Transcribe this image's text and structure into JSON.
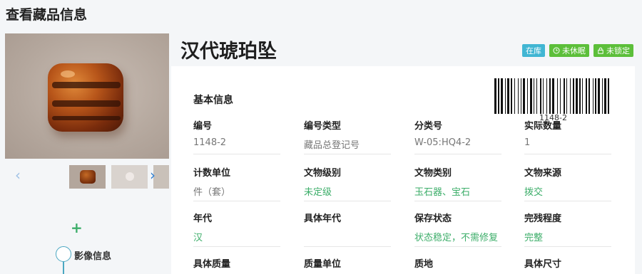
{
  "page": {
    "title": "查看藏品信息"
  },
  "gallery": {
    "prev_icon": "chevron-left-icon",
    "next_icon": "chevron-right-icon"
  },
  "timeline": {
    "add_icon": "plus-icon",
    "label": "影像信息"
  },
  "relic": {
    "name": "汉代琥珀坠",
    "badges": [
      {
        "label": "在库",
        "icon": "",
        "color": "#41b6d3"
      },
      {
        "label": "未休眠",
        "icon": "clock-icon",
        "color": "#5cbf3a"
      },
      {
        "label": "未锁定",
        "icon": "lock-icon",
        "color": "#5cbf3a"
      }
    ],
    "barcode_text": "1148-2"
  },
  "basic_info": {
    "section_title": "基本信息",
    "fields": [
      {
        "label": "编号",
        "value": "1148-2"
      },
      {
        "label": "编号类型",
        "value": "藏品总登记号"
      },
      {
        "label": "分类号",
        "value": "W-05:HQ4-2"
      },
      {
        "label": "实际数量",
        "value": "1"
      },
      {
        "label": "计数单位",
        "value": "件（套）"
      },
      {
        "label": "文物级别",
        "value": "未定级"
      },
      {
        "label": "文物类别",
        "value": "玉石器、宝石"
      },
      {
        "label": "文物来源",
        "value": "拨交"
      },
      {
        "label": "年代",
        "value": "汉"
      },
      {
        "label": "具体年代",
        "value": ""
      },
      {
        "label": "保存状态",
        "value": "状态稳定，不需修复"
      },
      {
        "label": "完残程度",
        "value": "完整"
      },
      {
        "label": "具体质量",
        "value": ""
      },
      {
        "label": "质量单位",
        "value": ""
      },
      {
        "label": "质地",
        "value": ""
      },
      {
        "label": "具体尺寸",
        "value": ""
      }
    ]
  },
  "colors": {
    "accent_green": "#3dae6a",
    "badge_blue": "#41b6d3",
    "badge_green": "#5cbf3a"
  }
}
